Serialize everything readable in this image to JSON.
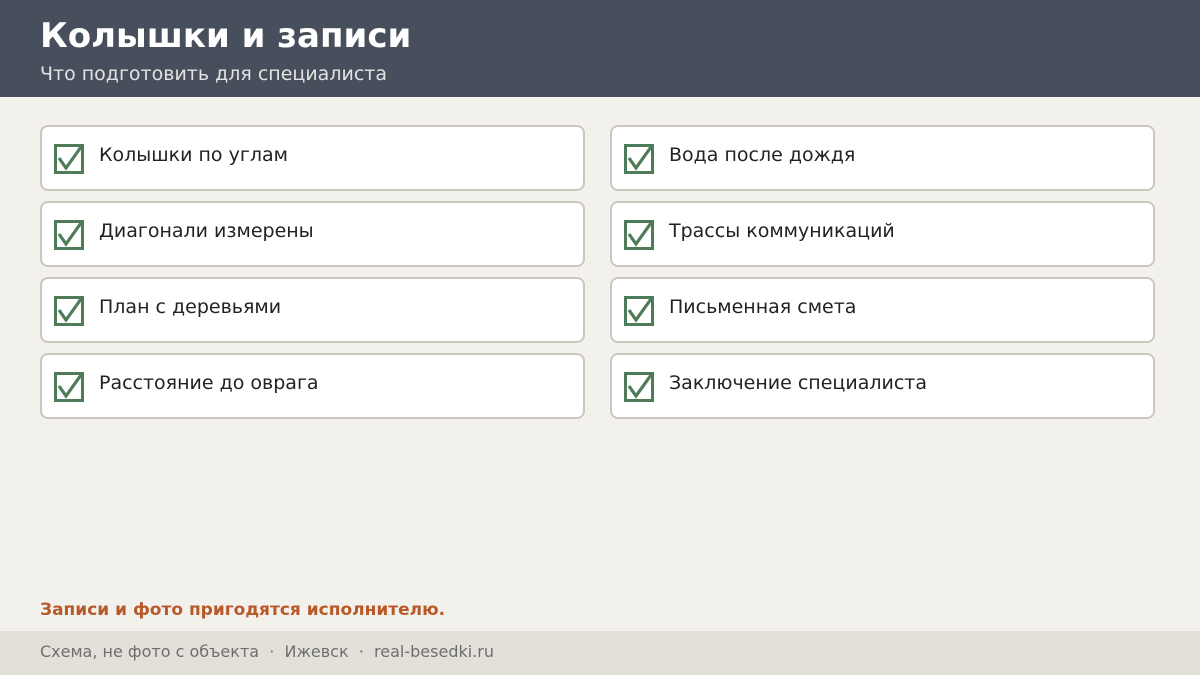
{
  "header": {
    "title": "Колышки и записи",
    "subtitle": "Что подготовить для специалиста"
  },
  "checklist": {
    "items": [
      {
        "label": "Колышки по углам",
        "checked": true,
        "icon": "checkbox-checked-icon"
      },
      {
        "label": "Вода после дождя",
        "checked": true,
        "icon": "checkbox-checked-icon"
      },
      {
        "label": "Диагонали измерены",
        "checked": true,
        "icon": "checkbox-checked-icon"
      },
      {
        "label": "Трассы коммуникаций",
        "checked": true,
        "icon": "checkbox-checked-icon"
      },
      {
        "label": "План с деревьями",
        "checked": true,
        "icon": "checkbox-checked-icon"
      },
      {
        "label": "Письменная смета",
        "checked": true,
        "icon": "checkbox-checked-icon"
      },
      {
        "label": "Расстояние до оврага",
        "checked": true,
        "icon": "checkbox-checked-icon"
      },
      {
        "label": "Заключение специалиста",
        "checked": true,
        "icon": "checkbox-checked-icon"
      }
    ]
  },
  "note": "Записи и фото пригодятся исполнителю.",
  "footer": {
    "text": "Схема, не фото с объекта  ·  Ижевск  ·  real-besedki.ru"
  },
  "colors": {
    "header_bg": "#474f5c",
    "page_bg": "#f3f1ec",
    "check_green": "#4e7b58",
    "note_accent": "#b8592a",
    "footer_bg": "#e3e0d9"
  }
}
